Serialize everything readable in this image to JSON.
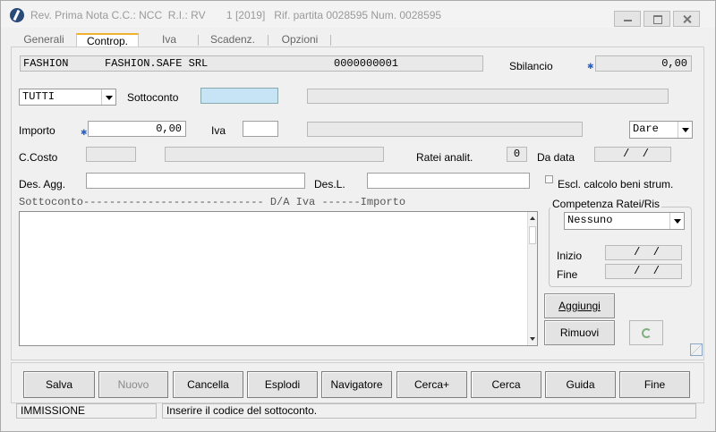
{
  "window": {
    "title": "Rev. Prima Nota C.C.: NCC  R.I.: RV       1 [2019]   Rif. partita 0028595 Num. 0028595"
  },
  "tabs": [
    {
      "label": "Generali",
      "active": false
    },
    {
      "label": "Controp.",
      "active": true
    },
    {
      "label": "Iva",
      "active": false
    },
    {
      "label": "Scadenz.",
      "active": false
    },
    {
      "label": "Opzioni",
      "active": false
    }
  ],
  "header": {
    "code": "FASHION",
    "company": "FASHION.SAFE SRL",
    "number": "0000000001",
    "sbilancio_label": "Sbilancio",
    "sbilancio_value": "0,00"
  },
  "form": {
    "filter_select": "TUTTI",
    "sottoconto_label": "Sottoconto",
    "sottoconto_value": "",
    "importo_label": "Importo",
    "importo_value": "0,00",
    "iva_label": "Iva",
    "iva_value": "",
    "dare_select": "Dare",
    "ccosto_label": "C.Costo",
    "ratei_label": "Ratei analit.",
    "ratei_value": "0",
    "da_data_label": "Da data",
    "da_data_value": " /  /",
    "des_agg_label": "Des. Agg.",
    "des_l_label": "Des.L.",
    "escl_label": "Escl. calcolo beni strum."
  },
  "list": {
    "header": "Sottoconto---------------------------- D/A  Iva   ------Importo"
  },
  "competenza": {
    "title": "Competenza Ratei/Ris",
    "select": "Nessuno",
    "inizio_label": "Inizio",
    "inizio_value": " /  /",
    "fine_label": "Fine",
    "fine_value": " /  /"
  },
  "side_buttons": {
    "aggiungi": "Aggiungi",
    "rimuovi": "Rimuovi"
  },
  "toolbar": [
    {
      "label": "Salva",
      "enabled": true
    },
    {
      "label": "Nuovo",
      "enabled": false
    },
    {
      "label": "Cancella",
      "enabled": true
    },
    {
      "label": "Esplodi",
      "enabled": true
    },
    {
      "label": "Navigatore",
      "enabled": true
    },
    {
      "label": "Cerca+",
      "enabled": true
    },
    {
      "label": "Cerca",
      "enabled": true
    },
    {
      "label": "Guida",
      "enabled": true
    },
    {
      "label": "Fine",
      "enabled": true
    }
  ],
  "status": {
    "mode": "IMMISSIONE",
    "message": "Inserire il codice del sottoconto."
  }
}
